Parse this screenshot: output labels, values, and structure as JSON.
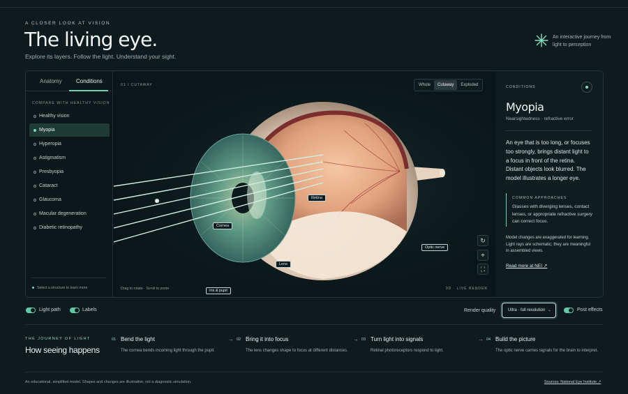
{
  "header": {
    "eyebrow": "A CLOSER LOOK AT VISION",
    "title": "The living eye.",
    "subtitle": "Explore its layers. Follow the light. Understand your sight.",
    "journey_note": "An interactive journey from light to perception"
  },
  "sidebar": {
    "tabs": [
      {
        "label": "Anatomy",
        "active": false
      },
      {
        "label": "Conditions",
        "active": true
      }
    ],
    "compare_label": "COMPARE WITH HEALTHY VISION",
    "conditions": [
      {
        "label": "Healthy vision",
        "active": false
      },
      {
        "label": "Myopia",
        "active": true
      },
      {
        "label": "Hyperopia",
        "active": false
      },
      {
        "label": "Astigmatism",
        "active": false
      },
      {
        "label": "Presbyopia",
        "active": false
      },
      {
        "label": "Cataract",
        "active": false
      },
      {
        "label": "Glaucoma",
        "active": false
      },
      {
        "label": "Macular degeneration",
        "active": false
      },
      {
        "label": "Diabetic retinopathy",
        "active": false
      }
    ],
    "hint": "Select a structure to learn more"
  },
  "viewport": {
    "label": "01 / CUTAWAY",
    "view_modes": [
      {
        "label": "Whole",
        "active": false
      },
      {
        "label": "Cutaway",
        "active": true
      },
      {
        "label": "Exploded",
        "active": false
      }
    ],
    "callouts": {
      "retina": "Retina",
      "cornea": "Cornea",
      "lens": "Lens",
      "iris": "Iris & pupil",
      "optic": "Optic nerve"
    },
    "controls": {
      "reset": "↻",
      "center": "⌖",
      "fullscreen": "⛶"
    },
    "footer_left": "Drag to rotate · Scroll to zoom",
    "footer_right": "3D · LIVE RENDER"
  },
  "details": {
    "eyebrow": "CONDITIONS",
    "title": "Myopia",
    "subtitle": "Nearsightedness · refractive error",
    "description": "An eye that is too long, or focuses too strongly, brings distant light to a focus in front of the retina. Distant objects look blurred. The model illustrates a longer eye.",
    "callout_heading": "COMMON APPROACHES",
    "callout_text": "Glasses with diverging lenses, contact lenses, or appropriate refractive surgery can correct focus.",
    "note": "Model changes are exaggerated for learning. Light rays are schematic; they are meaningful in assembled views.",
    "link": "Read more at NEI ↗"
  },
  "settings": {
    "light_path": "Light path",
    "labels": "Labels",
    "render_quality_label": "Render quality",
    "render_quality_value": "Ultra · full resolution",
    "post_effects": "Post effects"
  },
  "journey": {
    "eyebrow": "THE JOURNEY OF LIGHT",
    "title": "How seeing happens",
    "steps": [
      {
        "num": "01",
        "title": "Bend the light",
        "desc": "The cornea bends incoming light through the pupil."
      },
      {
        "num": "02",
        "title": "Bring it into focus",
        "desc": "The lens changes shape to focus at different distances."
      },
      {
        "num": "03",
        "title": "Turn light into signals",
        "desc": "Retinal photoreceptors respond to light."
      },
      {
        "num": "04",
        "title": "Build the picture",
        "desc": "The optic nerve carries signals for the brain to interpret."
      }
    ]
  },
  "footer": {
    "note": "An educational, simplified model. Shapes and changes are illustrative, not a diagnostic simulation.",
    "sources": "Sources: National Eye Institute ↗"
  },
  "colors": {
    "accent": "#6fd3b5",
    "background": "#0e1a1d"
  }
}
